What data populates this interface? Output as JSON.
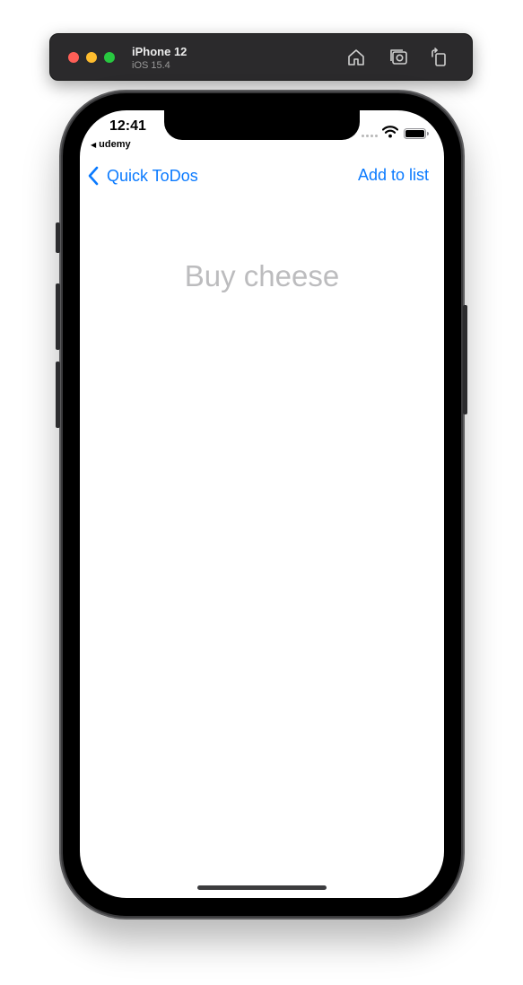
{
  "simulator": {
    "device_name": "iPhone 12",
    "os_version": "iOS 15.4",
    "toolbar_icons": [
      "home-icon",
      "screenshot-icon",
      "rotate-icon"
    ]
  },
  "status_bar": {
    "time": "12:41",
    "back_app": "udemy"
  },
  "nav_bar": {
    "back_label": "Quick ToDos",
    "action_label": "Add to list"
  },
  "todo_input": {
    "placeholder": "Buy cheese",
    "value": ""
  },
  "colors": {
    "accent": "#0a7aff",
    "placeholder": "#bcbcbe",
    "toolbar_bg": "#2b2a2c"
  }
}
